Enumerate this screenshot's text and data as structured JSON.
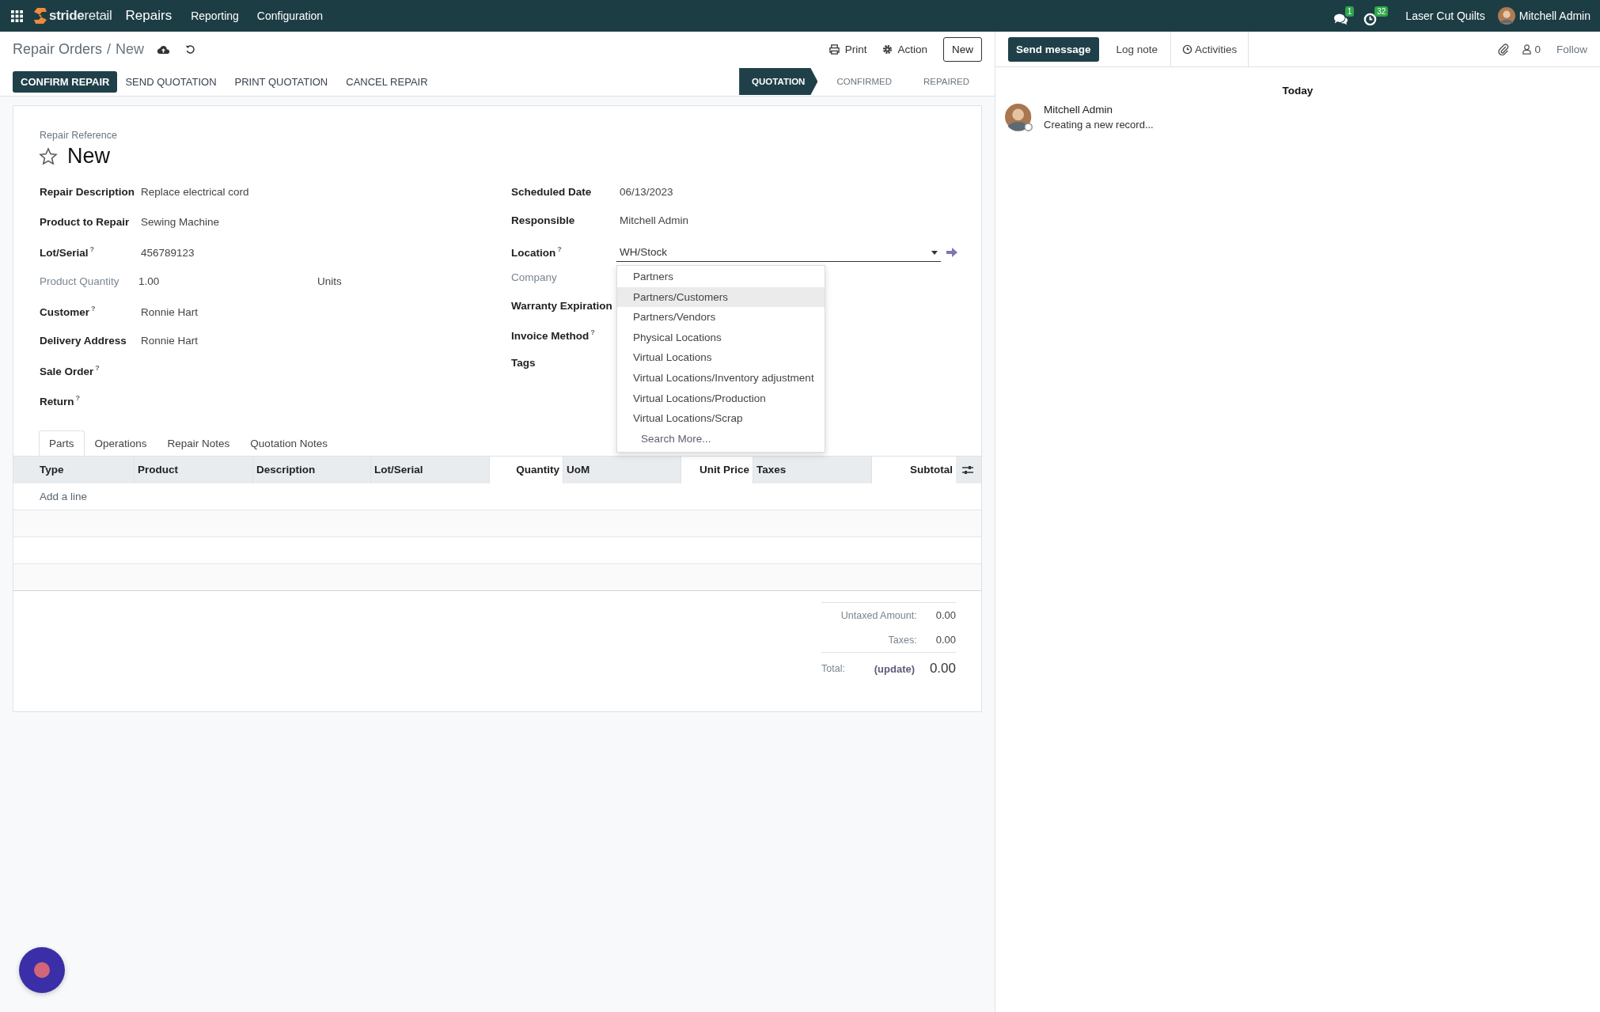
{
  "navbar": {
    "brand": "**stride**retail",
    "app": "Repairs",
    "menu": [
      {
        "label": "Reporting"
      },
      {
        "label": "Configuration"
      }
    ],
    "messages_badge": "1",
    "activities_badge": "32",
    "company": "Laser Cut Quilts",
    "user": "Mitchell Admin"
  },
  "breadcrumb": {
    "parent": "Repair Orders",
    "separator": "/",
    "current": "New"
  },
  "actions": [
    {
      "label": "Print",
      "kind": "print"
    },
    {
      "label": "Action",
      "kind": "gear"
    }
  ],
  "new_button": "New",
  "header_buttons": [
    {
      "label": "CONFIRM REPAIR",
      "kind": "primary"
    },
    {
      "label": "SEND QUOTATION",
      "kind": "secondary"
    },
    {
      "label": "PRINT QUOTATION",
      "kind": "secondary"
    },
    {
      "label": "CANCEL REPAIR",
      "kind": "secondary"
    }
  ],
  "stages": [
    {
      "label": "QUOTATION",
      "selected": true
    },
    {
      "label": "CONFIRMED",
      "selected": false
    },
    {
      "label": "REPAIRED",
      "selected": false
    }
  ],
  "form": {
    "reference_label": "Repair Reference",
    "name": "New",
    "starred": false,
    "left_fields": [
      {
        "label": "Repair Description",
        "value": "Replace electrical cord",
        "readonly": false
      },
      {
        "label": "Product to Repair",
        "value": "Sewing Machine",
        "readonly": false
      },
      {
        "label": "Lot/Serial",
        "help": "?",
        "value": "456789123",
        "readonly": false
      },
      {
        "label": "Product Quantity",
        "value": "1.00",
        "unit": "Units",
        "readonly": true
      },
      {
        "label": "Customer",
        "help": "?",
        "value": "Ronnie Hart",
        "readonly": false
      },
      {
        "label": "Delivery Address",
        "value": "Ronnie Hart",
        "readonly": false
      },
      {
        "label": "Sale Order",
        "help": "?",
        "readonly": false
      },
      {
        "label": "Return",
        "help": "?",
        "readonly": false
      }
    ],
    "right_fields": [
      {
        "label": "Scheduled Date",
        "value": "06/13/2023",
        "kind": "text",
        "readonly": false
      },
      {
        "label": "Responsible",
        "value": "Mitchell Admin",
        "kind": "text",
        "readonly": false
      },
      {
        "label": "Location",
        "help": "?",
        "value": "WH/Stock",
        "kind": "select",
        "readonly": false
      },
      {
        "label": "Company",
        "kind": "text",
        "readonly": true
      },
      {
        "label": "Warranty Expiration",
        "kind": "text",
        "readonly": false
      },
      {
        "label": "Invoice Method",
        "help": "?",
        "kind": "text",
        "readonly": false
      },
      {
        "label": "Tags",
        "kind": "text",
        "readonly": false
      }
    ]
  },
  "location_dropdown": {
    "options": [
      {
        "label": "Partners",
        "selected": false
      },
      {
        "label": "Partners/Customers",
        "selected": true
      },
      {
        "label": "Partners/Vendors",
        "selected": false
      },
      {
        "label": "Physical Locations",
        "selected": false
      },
      {
        "label": "Virtual Locations",
        "selected": false
      },
      {
        "label": "Virtual Locations/Inventory adjustment",
        "selected": false
      },
      {
        "label": "Virtual Locations/Production",
        "selected": false
      },
      {
        "label": "Virtual Locations/Scrap",
        "selected": false
      }
    ],
    "search_more": "Search More..."
  },
  "tabs": [
    {
      "label": "Parts",
      "selected": true
    },
    {
      "label": "Operations",
      "selected": false
    },
    {
      "label": "Repair Notes",
      "selected": false
    },
    {
      "label": "Quotation Notes",
      "selected": false
    }
  ],
  "table": {
    "columns": [
      {
        "label": "Type",
        "kind": "text"
      },
      {
        "label": "Product",
        "kind": "text"
      },
      {
        "label": "Description",
        "kind": "text"
      },
      {
        "label": "Lot/Serial",
        "kind": "text"
      },
      {
        "label": "Quantity",
        "kind": "number"
      },
      {
        "label": "UoM",
        "kind": "text"
      },
      {
        "label": "Unit Price",
        "kind": "number"
      },
      {
        "label": "Taxes",
        "kind": "text"
      },
      {
        "label": "Subtotal",
        "kind": "number"
      }
    ],
    "add_line": "Add a line"
  },
  "totals": {
    "untaxed_label": "Untaxed Amount:",
    "untaxed": "0.00",
    "taxes_label": "Taxes:",
    "taxes": "0.00",
    "total_label": "Total:",
    "update": "(update)",
    "total": "0.00"
  },
  "chatter": {
    "send_message": "Send message",
    "log_note": "Log note",
    "activities": "Activities",
    "followers": "0",
    "follow": "Follow",
    "date": "Today",
    "messages": [
      {
        "author": "Mitchell Admin",
        "body": "Creating a new record..."
      }
    ]
  }
}
